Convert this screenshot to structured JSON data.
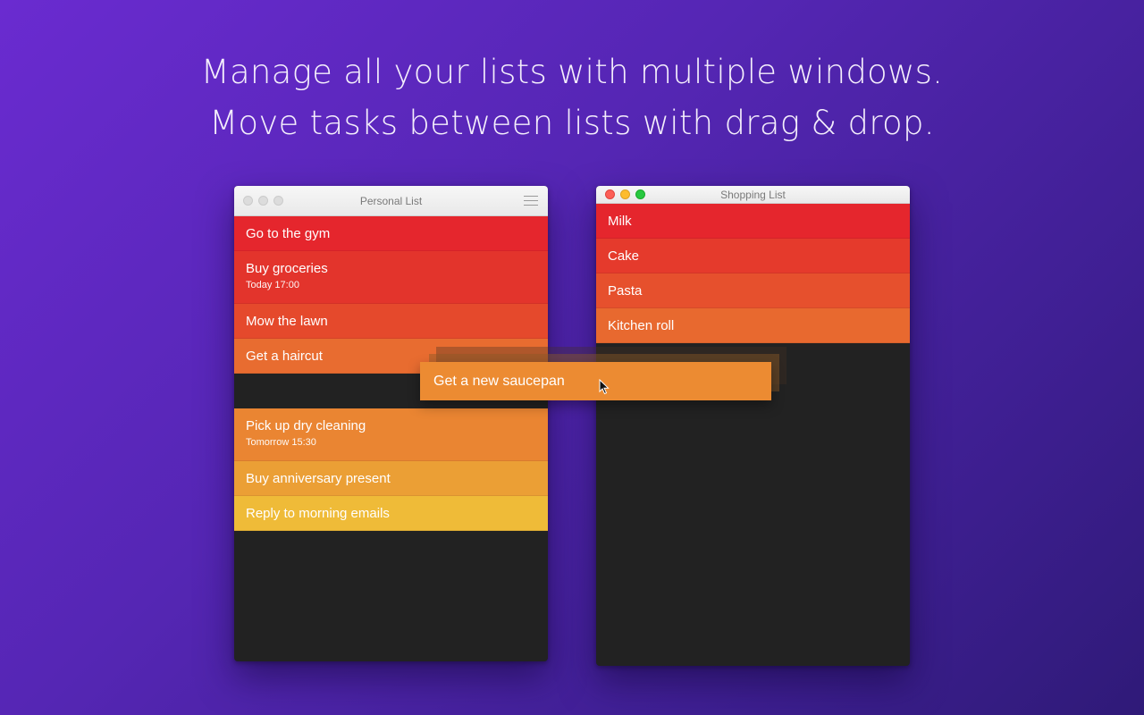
{
  "headline": {
    "line1": "Manage all your lists with multiple windows.",
    "line2": "Move tasks between lists with drag & drop."
  },
  "personal_window": {
    "title": "Personal List",
    "tasks": [
      {
        "title": "Go to the gym",
        "date": "",
        "color": "#e5262d"
      },
      {
        "title": "Buy groceries",
        "date": "Today 17:00",
        "color": "#e3342c"
      },
      {
        "title": "Mow the lawn",
        "date": "",
        "color": "#e5492c"
      },
      {
        "title": "Get a haircut",
        "date": "",
        "color": "#e86c30"
      },
      {
        "title": "Pick up dry cleaning",
        "date": "Tomorrow 15:30",
        "color": "#ea8532"
      },
      {
        "title": "Buy anniversary present",
        "date": "",
        "color": "#eb9f35"
      },
      {
        "title": "Reply to morning emails",
        "date": "",
        "color": "#efbb38"
      }
    ]
  },
  "shopping_window": {
    "title": "Shopping List",
    "tasks": [
      {
        "title": "Milk",
        "color": "#e5262d"
      },
      {
        "title": "Cake",
        "color": "#e53a2c"
      },
      {
        "title": "Pasta",
        "color": "#e6502d"
      },
      {
        "title": "Kitchen roll",
        "color": "#e8692f"
      }
    ]
  },
  "dragged_task": {
    "title": "Get a new saucepan",
    "color": "#ec8b32"
  },
  "icons": {
    "traffic_lights": [
      "close-icon",
      "minimize-icon",
      "zoom-icon"
    ],
    "menu": "hamburger-menu-icon",
    "cursor": "mouse-pointer-icon"
  }
}
